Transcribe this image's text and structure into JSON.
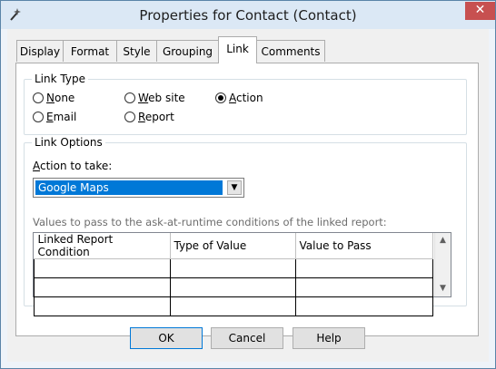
{
  "window": {
    "title": "Properties for Contact (Contact)",
    "close_glyph": "✕",
    "app_icon": "wand-icon"
  },
  "tabs": [
    {
      "label": "Display",
      "active": false
    },
    {
      "label": "Format",
      "active": false
    },
    {
      "label": "Style",
      "active": false
    },
    {
      "label": "Grouping",
      "active": false
    },
    {
      "label": "Link",
      "active": true
    },
    {
      "label": "Comments",
      "active": false
    }
  ],
  "link_type": {
    "group_label": "Link Type",
    "options": [
      {
        "label": "None",
        "mnemonic": "N",
        "rest": "one",
        "selected": false
      },
      {
        "label": "Web site",
        "mnemonic": "W",
        "rest": "eb site",
        "selected": false
      },
      {
        "label": "Action",
        "mnemonic": "A",
        "rest": "ction",
        "selected": true
      },
      {
        "label": "Email",
        "mnemonic": "E",
        "rest": "mail",
        "selected": false
      },
      {
        "label": "Report",
        "mnemonic": "R",
        "rest": "eport",
        "selected": false
      }
    ]
  },
  "link_options": {
    "group_label": "Link Options",
    "action_label_mnemonic": "A",
    "action_label_rest": "ction to take:",
    "action_value": "Google Maps",
    "hint": "Values to pass to the ask-at-runtime conditions of the linked report:",
    "columns": [
      "Linked Report Condition",
      "Type of Value",
      "Value to Pass"
    ],
    "rows": [
      [
        "",
        "",
        ""
      ],
      [
        "",
        "",
        ""
      ],
      [
        "",
        "",
        ""
      ]
    ]
  },
  "buttons": {
    "ok": "OK",
    "cancel": "Cancel",
    "help": "Help"
  },
  "colors": {
    "selection": "#0078d7",
    "close_button": "#c75050",
    "titlebar": "#dbe8f5"
  }
}
